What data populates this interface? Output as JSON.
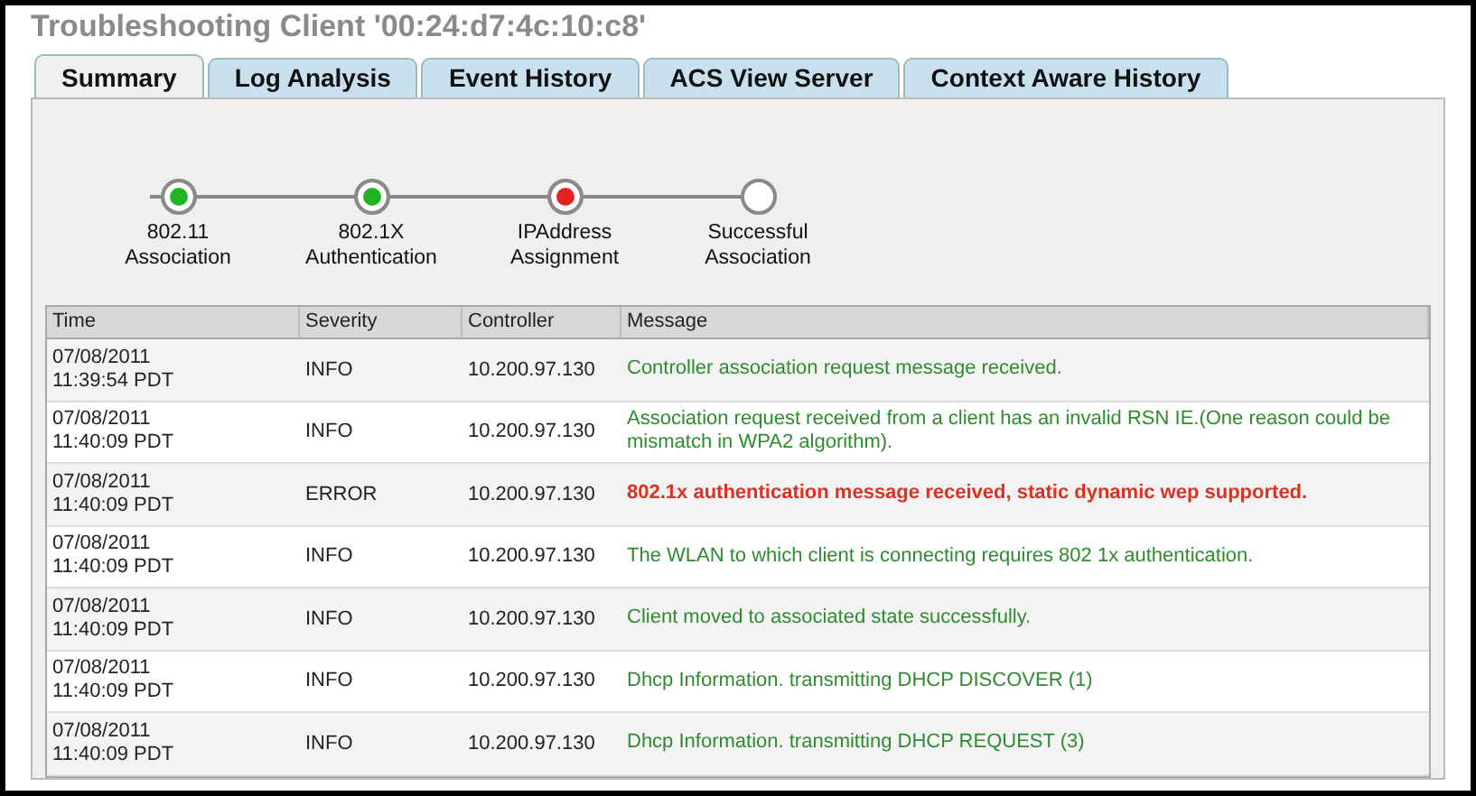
{
  "window": {
    "title": "Troubleshooting Client '00:24:d7:4c:10:c8'"
  },
  "tabs": [
    {
      "label": "Summary",
      "selected": true
    },
    {
      "label": "Log Analysis",
      "selected": false
    },
    {
      "label": "Event History",
      "selected": false
    },
    {
      "label": "ACS View Server",
      "selected": false
    },
    {
      "label": "Context Aware History",
      "selected": false
    }
  ],
  "steps": [
    {
      "label": "802.11\nAssociation",
      "color": "#22b522"
    },
    {
      "label": "802.1X\nAuthentication",
      "color": "#22b522"
    },
    {
      "label": "IPAddress\nAssignment",
      "color": "#e62020"
    },
    {
      "label": "Successful\nAssociation",
      "color": "#ffffff"
    }
  ],
  "table": {
    "columns": [
      "Time",
      "Severity",
      "Controller",
      "Message"
    ],
    "rows": [
      {
        "time": "07/08/2011\n11:39:54 PDT",
        "severity": "INFO",
        "kind": "info",
        "controller": "10.200.97.130",
        "message": "Controller association request message received."
      },
      {
        "time": "07/08/2011\n11:40:09 PDT",
        "severity": "INFO",
        "kind": "info",
        "controller": "10.200.97.130",
        "message": "Association request received from a client has an invalid RSN IE.(One reason could be mismatch in WPA2 algorithm)."
      },
      {
        "time": "07/08/2011\n11:40:09 PDT",
        "severity": "ERROR",
        "kind": "error",
        "controller": "10.200.97.130",
        "message": "802.1x authentication message received, static dynamic wep supported."
      },
      {
        "time": "07/08/2011\n11:40:09 PDT",
        "severity": "INFO",
        "kind": "info",
        "controller": "10.200.97.130",
        "message": "The WLAN to which client is connecting requires 802 1x authentication."
      },
      {
        "time": "07/08/2011\n11:40:09 PDT",
        "severity": "INFO",
        "kind": "info",
        "controller": "10.200.97.130",
        "message": "Client moved to associated state successfully."
      },
      {
        "time": "07/08/2011\n11:40:09 PDT",
        "severity": "INFO",
        "kind": "info",
        "controller": "10.200.97.130",
        "message": "Dhcp Information. transmitting DHCP DISCOVER (1)"
      },
      {
        "time": "07/08/2011\n11:40:09 PDT",
        "severity": "INFO",
        "kind": "info",
        "controller": "10.200.97.130",
        "message": "Dhcp Information. transmitting DHCP REQUEST (3)"
      }
    ]
  }
}
